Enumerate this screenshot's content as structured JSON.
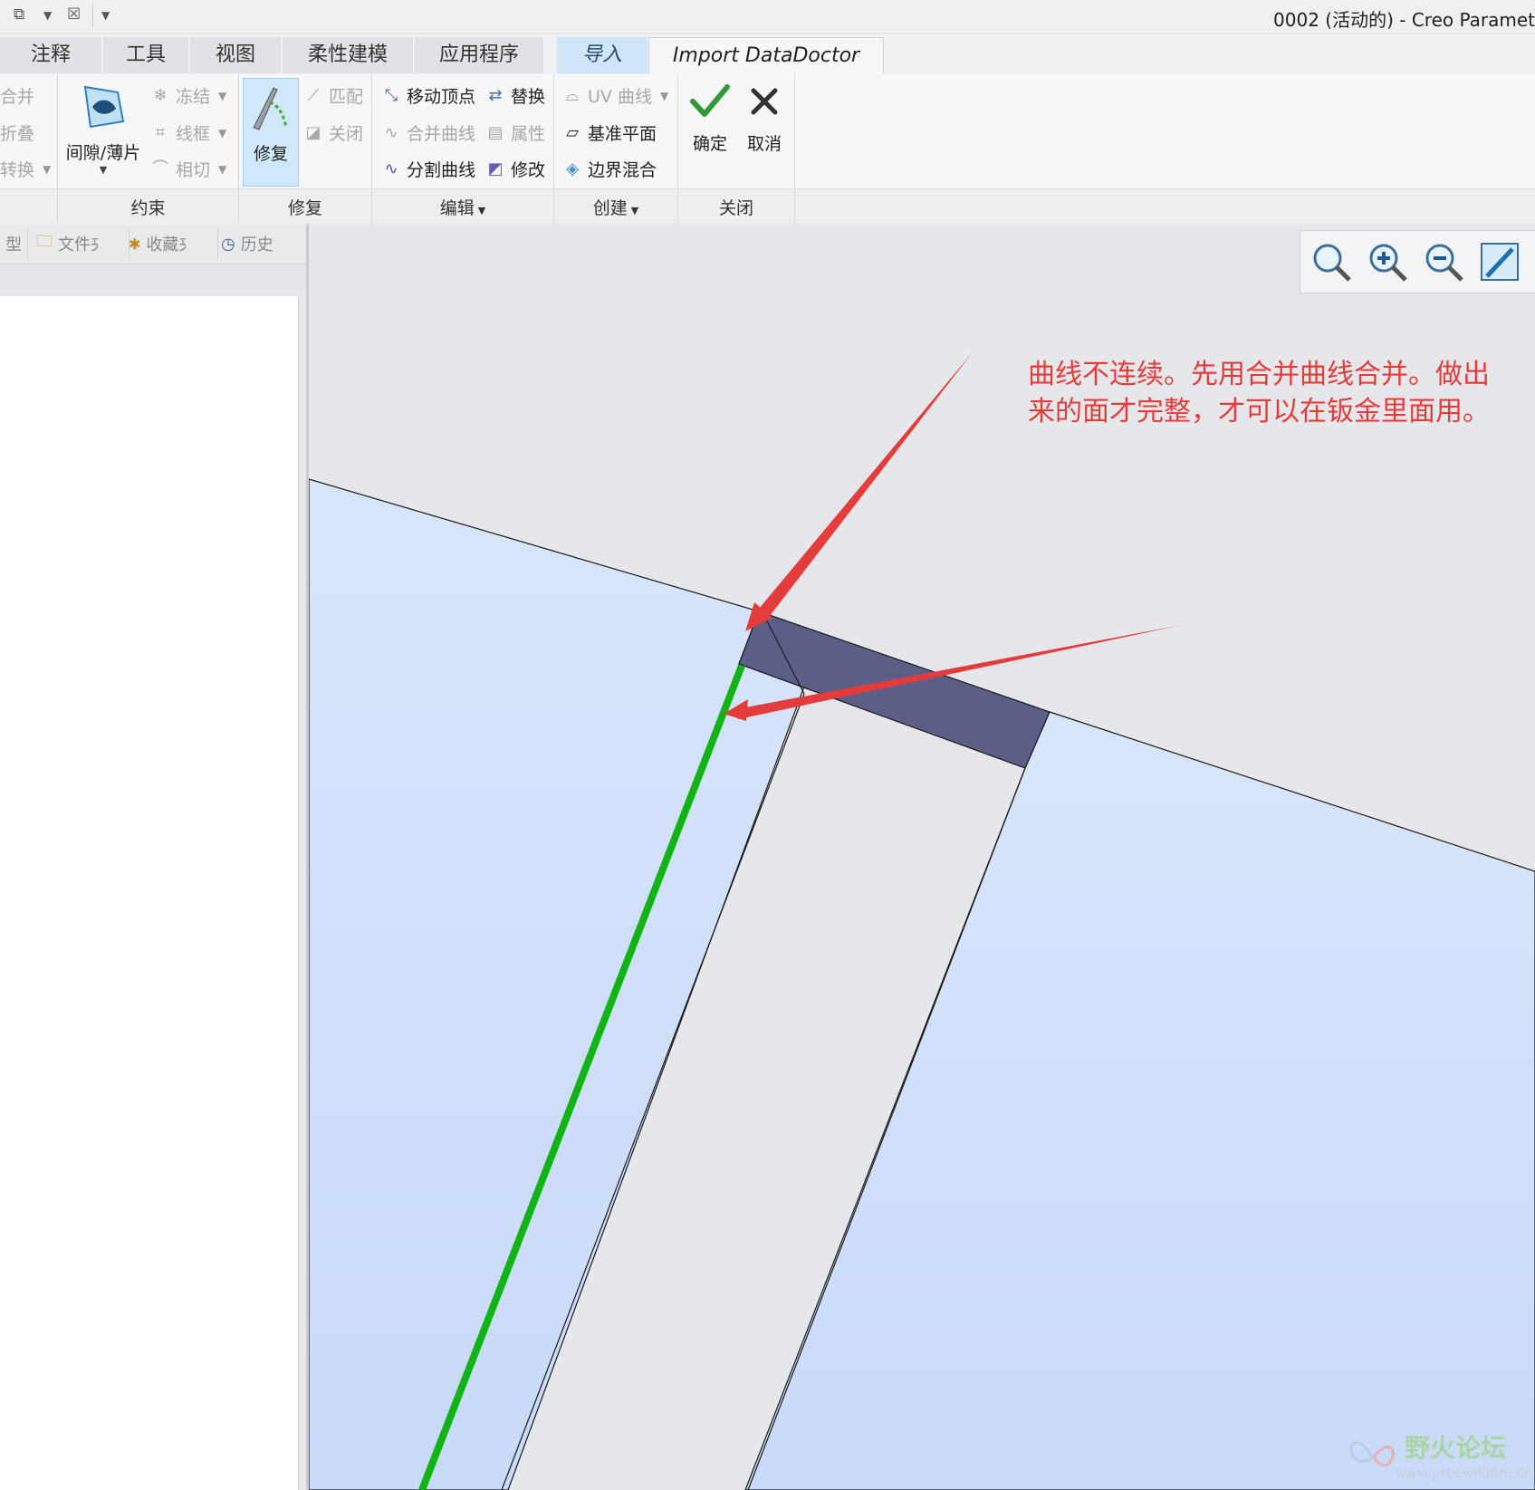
{
  "window": {
    "title": "0002 (活动的) - Creo Paramet"
  },
  "quick_access": {
    "icons": [
      "window-switch-icon",
      "chevron-down-icon",
      "close-windows-icon",
      "customize-dropdown-icon"
    ]
  },
  "tabs": [
    "注释",
    "工具",
    "视图",
    "柔性建模",
    "应用程序",
    "导入",
    "Import DataDoctor"
  ],
  "ribbon": {
    "partial_left": [
      "合并",
      "折叠",
      "转换"
    ],
    "gap_shell": "间隙/薄片",
    "constraint_items": [
      "冻结",
      "线框",
      "相切"
    ],
    "repair_big": "修复",
    "repair_items": [
      "匹配",
      "关闭"
    ],
    "edit_items": [
      "移动顶点",
      "合并曲线",
      "分割曲线"
    ],
    "edit_items_right": [
      "替换",
      "属性",
      "修改"
    ],
    "create_items": [
      "UV 曲线",
      "基准平面",
      "边界混合"
    ],
    "ok": "确定",
    "cancel": "取消",
    "groups": [
      "约束",
      "修复",
      "编辑",
      "创建",
      "关闭"
    ]
  },
  "nav_tabs": [
    "型",
    "文件夹",
    "收藏夹",
    "历史"
  ],
  "annotation": {
    "line1": "曲线不连续。先用合并曲线合并。做出",
    "line2": "来的面才完整，才可以在钣金里面用。"
  },
  "watermark": {
    "brand": "野火论坛",
    "url": "www.proewildfire.cn"
  },
  "colors": {
    "surface": "#cfe0fa",
    "dark_patch": "#5b5f88",
    "annotation": "#e43b3b",
    "green_edge": "#10b515",
    "background": "#e6e7ea"
  }
}
